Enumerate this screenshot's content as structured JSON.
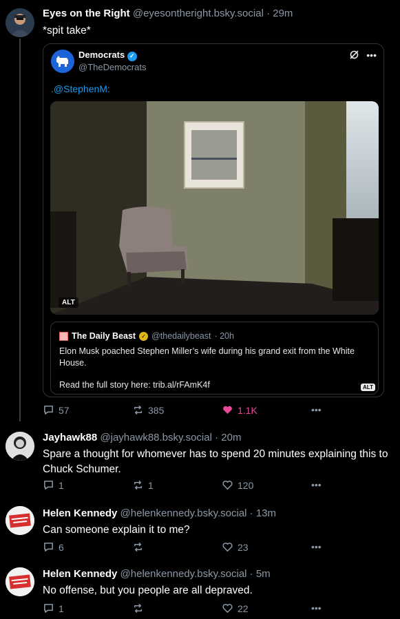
{
  "posts": [
    {
      "author_name": "Eyes on the Right",
      "handle": "@eyesontheright.bsky.social",
      "time": "· 29m",
      "text": "*spit take*",
      "embed": {
        "author_name": "Democrats",
        "handle": "@TheDemocrats",
        "text": ".@StephenM:",
        "photo_alt_label": "ALT",
        "quote": {
          "author_name": "The Daily Beast",
          "handle": "@thedailybeast",
          "time": "· 20h",
          "text": "Elon Musk poached Stephen Miller’s wife during his grand exit from the White House.",
          "link_text": "Read the full story here: trib.al/rFAmK4f",
          "alt_label": "ALT"
        }
      },
      "replies": "57",
      "reposts": "385",
      "likes": "1.1K"
    },
    {
      "author_name": "Jayhawk88",
      "handle": "@jayhawk88.bsky.social",
      "time": "· 20m",
      "text": "Spare a thought for whomever has to spend 20 minutes explaining this to Chuck Schumer.",
      "replies": "1",
      "reposts": "1",
      "likes": "120"
    },
    {
      "author_name": "Helen Kennedy",
      "handle": "@helenkennedy.bsky.social",
      "time": "· 13m",
      "text": "Can someone explain it to me?",
      "replies": "6",
      "reposts": "",
      "likes": "23"
    },
    {
      "author_name": "Helen Kennedy",
      "handle": "@helenkennedy.bsky.social",
      "time": "· 5m",
      "text": "No offense, but you people are all depraved.",
      "replies": "1",
      "reposts": "",
      "likes": "22"
    }
  ],
  "avatar_badge_text": "AN ENEMY OF THE PEOPLE",
  "colors": {
    "background": "#000000",
    "like_active": "#ec4899",
    "link": "#1d9bf0",
    "muted": "#8b98a5"
  },
  "icons": [
    "reply-icon",
    "repost-icon",
    "like-icon",
    "more-icon",
    "verified-icon",
    "x-logo-icon",
    "donkey-logo-icon"
  ]
}
